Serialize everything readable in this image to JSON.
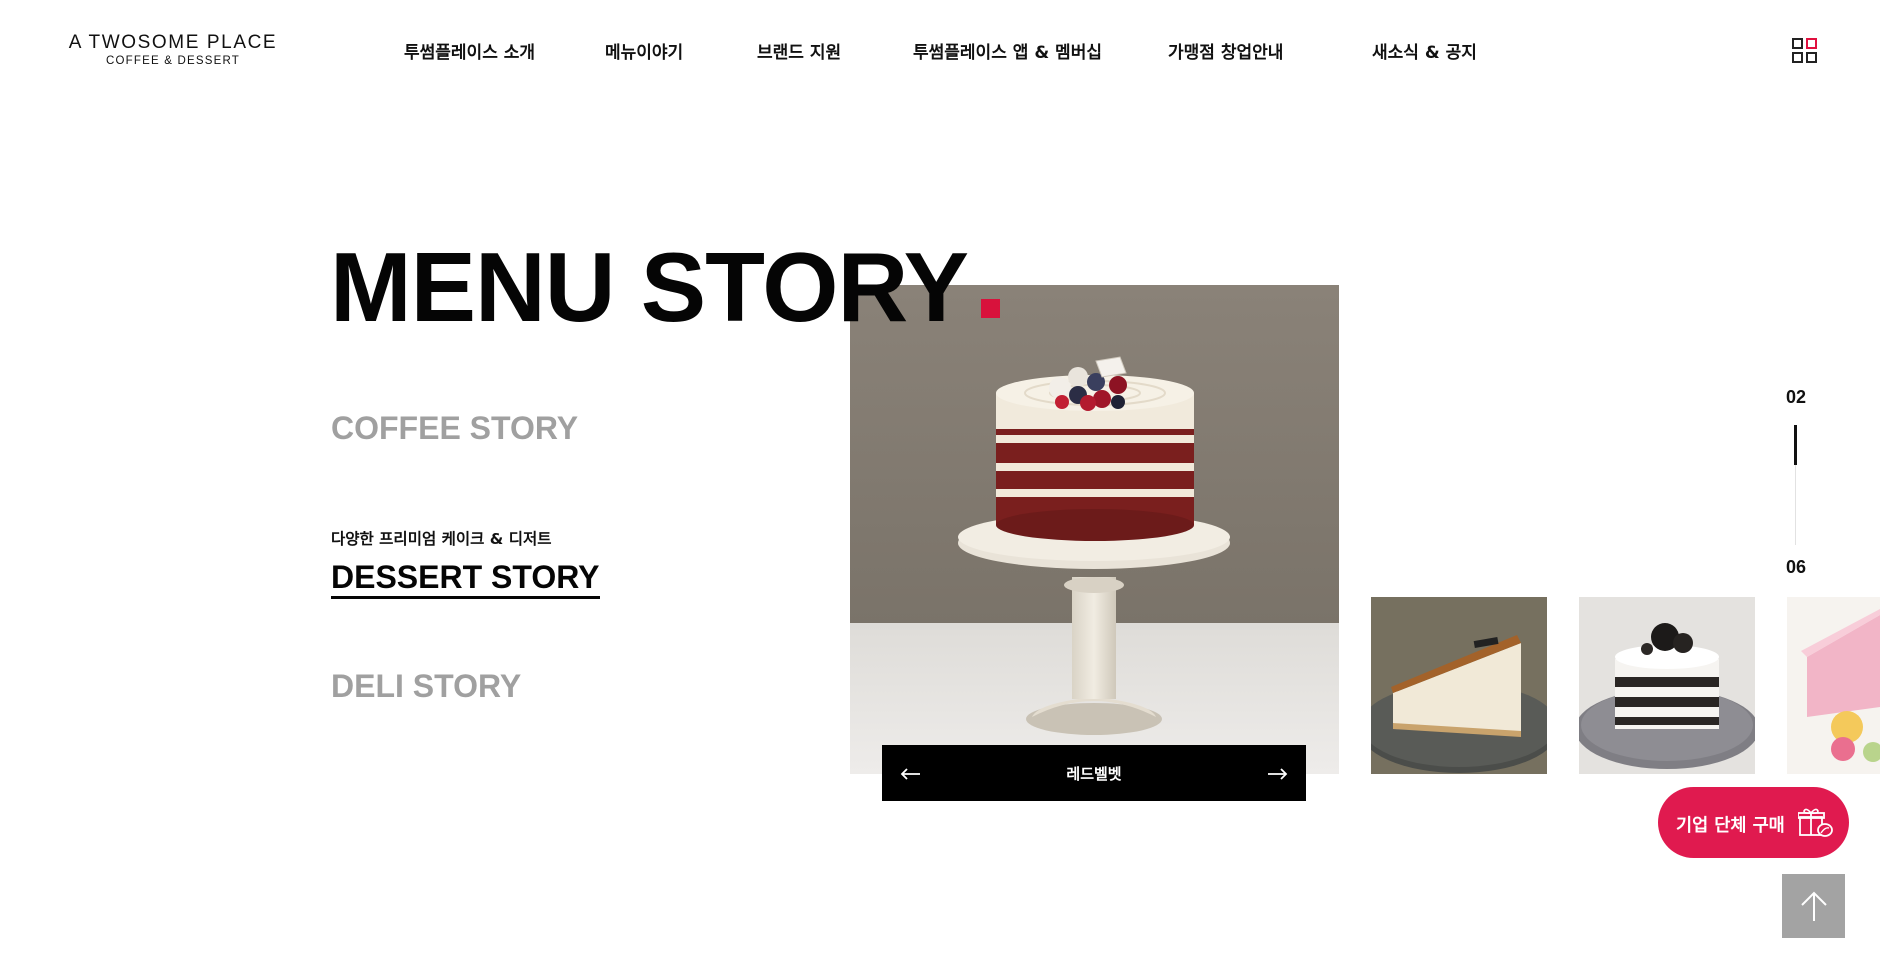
{
  "header": {
    "logo_main": "A TWOSOME PLACE",
    "logo_sub": "COFFEE & DESSERT",
    "nav": [
      {
        "label": "투썸플레이스 소개"
      },
      {
        "label": "메뉴이야기"
      },
      {
        "label": "브랜드 지원"
      },
      {
        "label": "투썸플레이스 앱 & 멤버십"
      },
      {
        "label": "가맹점 창업안내"
      },
      {
        "label": "새소식 & 공지"
      }
    ],
    "grid_menu_icon": "grid-icon"
  },
  "main": {
    "title": "MENU STORY",
    "accent_color": "#d8123c",
    "stories": {
      "coffee": "COFFEE STORY",
      "dessert_subtitle": "다양한 프리미엄 케이크 & 디저트",
      "dessert": "DESSERT STORY",
      "deli": "DELI STORY"
    },
    "active_story": "DESSERT STORY",
    "slider": {
      "current_name": "레드벨벳",
      "prev_icon": "arrow-left-icon",
      "next_icon": "arrow-right-icon",
      "thumbnails": [
        "cheesecake",
        "oreo cake",
        "macaron box"
      ]
    },
    "pagination": {
      "current": "02",
      "total": "06",
      "progress": 0.33
    }
  },
  "floating": {
    "corporate_button": "기업 단체 구매",
    "corporate_icon": "gift-coffee-icon",
    "corporate_color": "#e01a4f",
    "top_button_icon": "arrow-up-icon"
  }
}
